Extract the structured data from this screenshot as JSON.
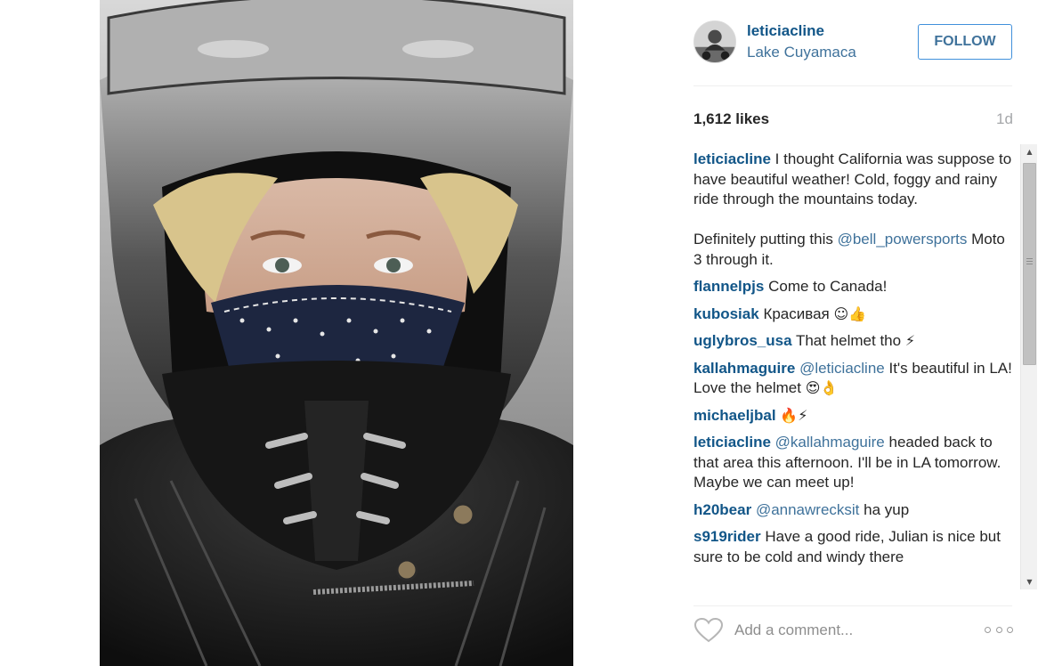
{
  "post": {
    "username": "leticiacline",
    "location": "Lake Cuyamaca",
    "follow_label": "FOLLOW",
    "likes": "1,612 likes",
    "time": "1d"
  },
  "comments": [
    {
      "author": "leticiacline",
      "parts": [
        {
          "type": "text",
          "value": "I thought California was suppose to have beautiful weather! Cold, foggy and rainy ride through the mountains today.\n\nDefinitely putting this "
        },
        {
          "type": "mention",
          "value": "@bell_powersports"
        },
        {
          "type": "text",
          "value": " Moto 3 through it."
        }
      ]
    },
    {
      "author": "flannelpjs",
      "parts": [
        {
          "type": "text",
          "value": "Come to Canada!"
        }
      ]
    },
    {
      "author": "kubosiak",
      "parts": [
        {
          "type": "text",
          "value": "Красивая "
        },
        {
          "type": "emoji",
          "value": "☺👍"
        }
      ]
    },
    {
      "author": "uglybros_usa",
      "parts": [
        {
          "type": "text",
          "value": "That helmet tho "
        },
        {
          "type": "emoji",
          "value": "⚡"
        }
      ]
    },
    {
      "author": "kallahmaguire",
      "parts": [
        {
          "type": "mention",
          "value": "@leticiacline"
        },
        {
          "type": "text",
          "value": " It's beautiful in LA! Love the helmet "
        },
        {
          "type": "emoji",
          "value": "😍👌"
        }
      ]
    },
    {
      "author": "michaeljbal",
      "parts": [
        {
          "type": "emoji",
          "value": "🔥⚡"
        }
      ]
    },
    {
      "author": "leticiacline",
      "parts": [
        {
          "type": "mention",
          "value": "@kallahmaguire"
        },
        {
          "type": "text",
          "value": " headed back to that area this afternoon. I'll be in LA tomorrow. Maybe we can meet up!"
        }
      ]
    },
    {
      "author": "h20bear",
      "parts": [
        {
          "type": "mention",
          "value": "@annawrecksit"
        },
        {
          "type": "text",
          "value": " ha yup"
        }
      ]
    },
    {
      "author": "s919rider",
      "parts": [
        {
          "type": "text",
          "value": "Have a good ride, Julian is nice but sure to be cold and windy there"
        }
      ]
    }
  ],
  "footer": {
    "comment_placeholder": "Add a comment...",
    "like_icon": "heart-outline-icon",
    "more_icon": "more-options-icon"
  },
  "colors": {
    "link": "#125688",
    "mention": "#3f729b",
    "follow_border": "#4090db",
    "muted": "#a5a7aa"
  }
}
